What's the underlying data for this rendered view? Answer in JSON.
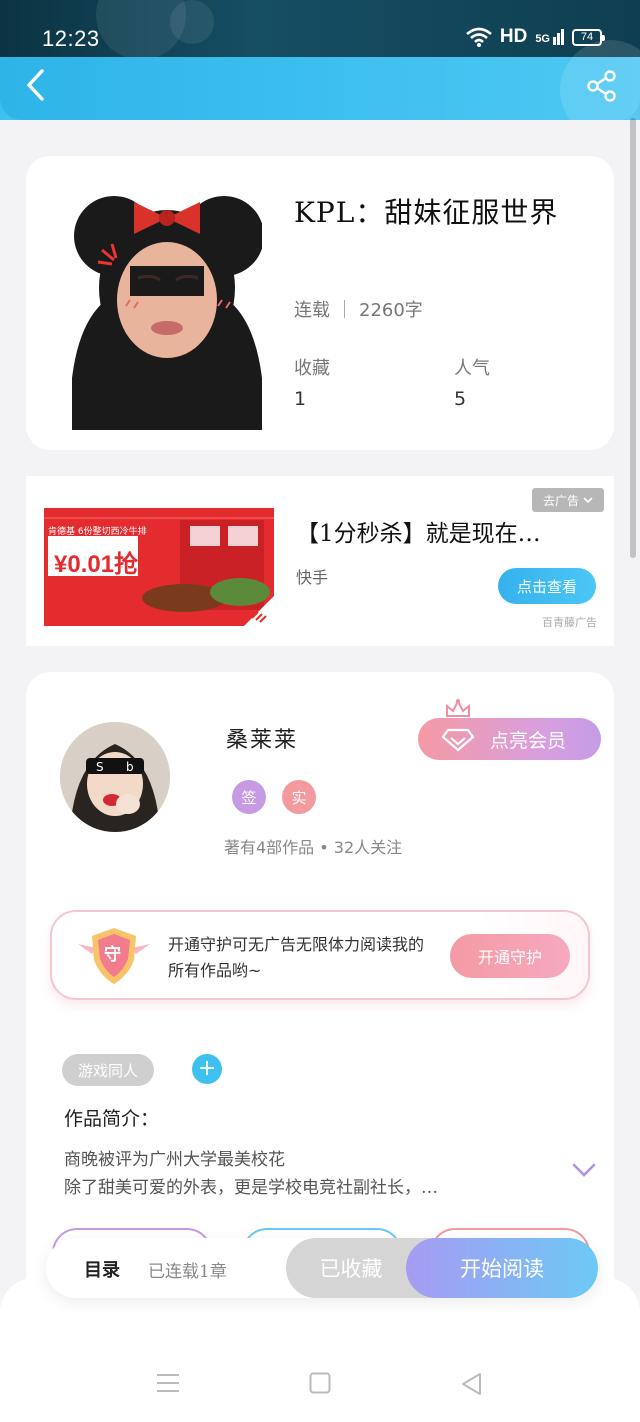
{
  "status_bar": {
    "time": "12:23",
    "network": "HD",
    "signal": "5G",
    "battery": "74"
  },
  "header": {
    "back_icon": "chevron-left-icon",
    "share_icon": "share-icon"
  },
  "book": {
    "title": "KPL：甜妹征服世界",
    "status": "连载",
    "word_count": "2260字",
    "favorites_label": "收藏",
    "favorites_value": "1",
    "popularity_label": "人气",
    "popularity_value": "5"
  },
  "ad": {
    "title": "【1分秒杀】就是现在…",
    "source": "快手",
    "button": "点击查看",
    "close_label": "去广告",
    "provider": "百青藤广告",
    "image_price": "¥0.01抢",
    "image_caption": "肯德基 6份整切西冷牛排"
  },
  "author": {
    "name": "桑莱莱",
    "badges": [
      {
        "label": "签",
        "color": "#c79be3"
      },
      {
        "label": "实",
        "color": "#f29a9e"
      }
    ],
    "info": "著有4部作品 • 32人关注",
    "vip_button": "点亮会员"
  },
  "guard": {
    "shield_label": "守",
    "text": "开通守护可无广告无限体力阅读我的所有作品哟~",
    "button": "开通守护"
  },
  "tags": {
    "items": [
      "游戏同人"
    ],
    "add_symbol": "+"
  },
  "intro": {
    "label": "作品简介：",
    "line1": "商晚被评为广州大学最美校花",
    "line2": "除了甜美可爱的外表，更是学校电竞社副社长，…"
  },
  "action_bar": {
    "catalog_label": "目录",
    "catalog_sub": "已连载1章",
    "collected": "已收藏",
    "read": "开始阅读"
  },
  "colors": {
    "accent_blue": "#3fc1f0",
    "pink": "#f59aa3",
    "purple": "#c79be3"
  }
}
